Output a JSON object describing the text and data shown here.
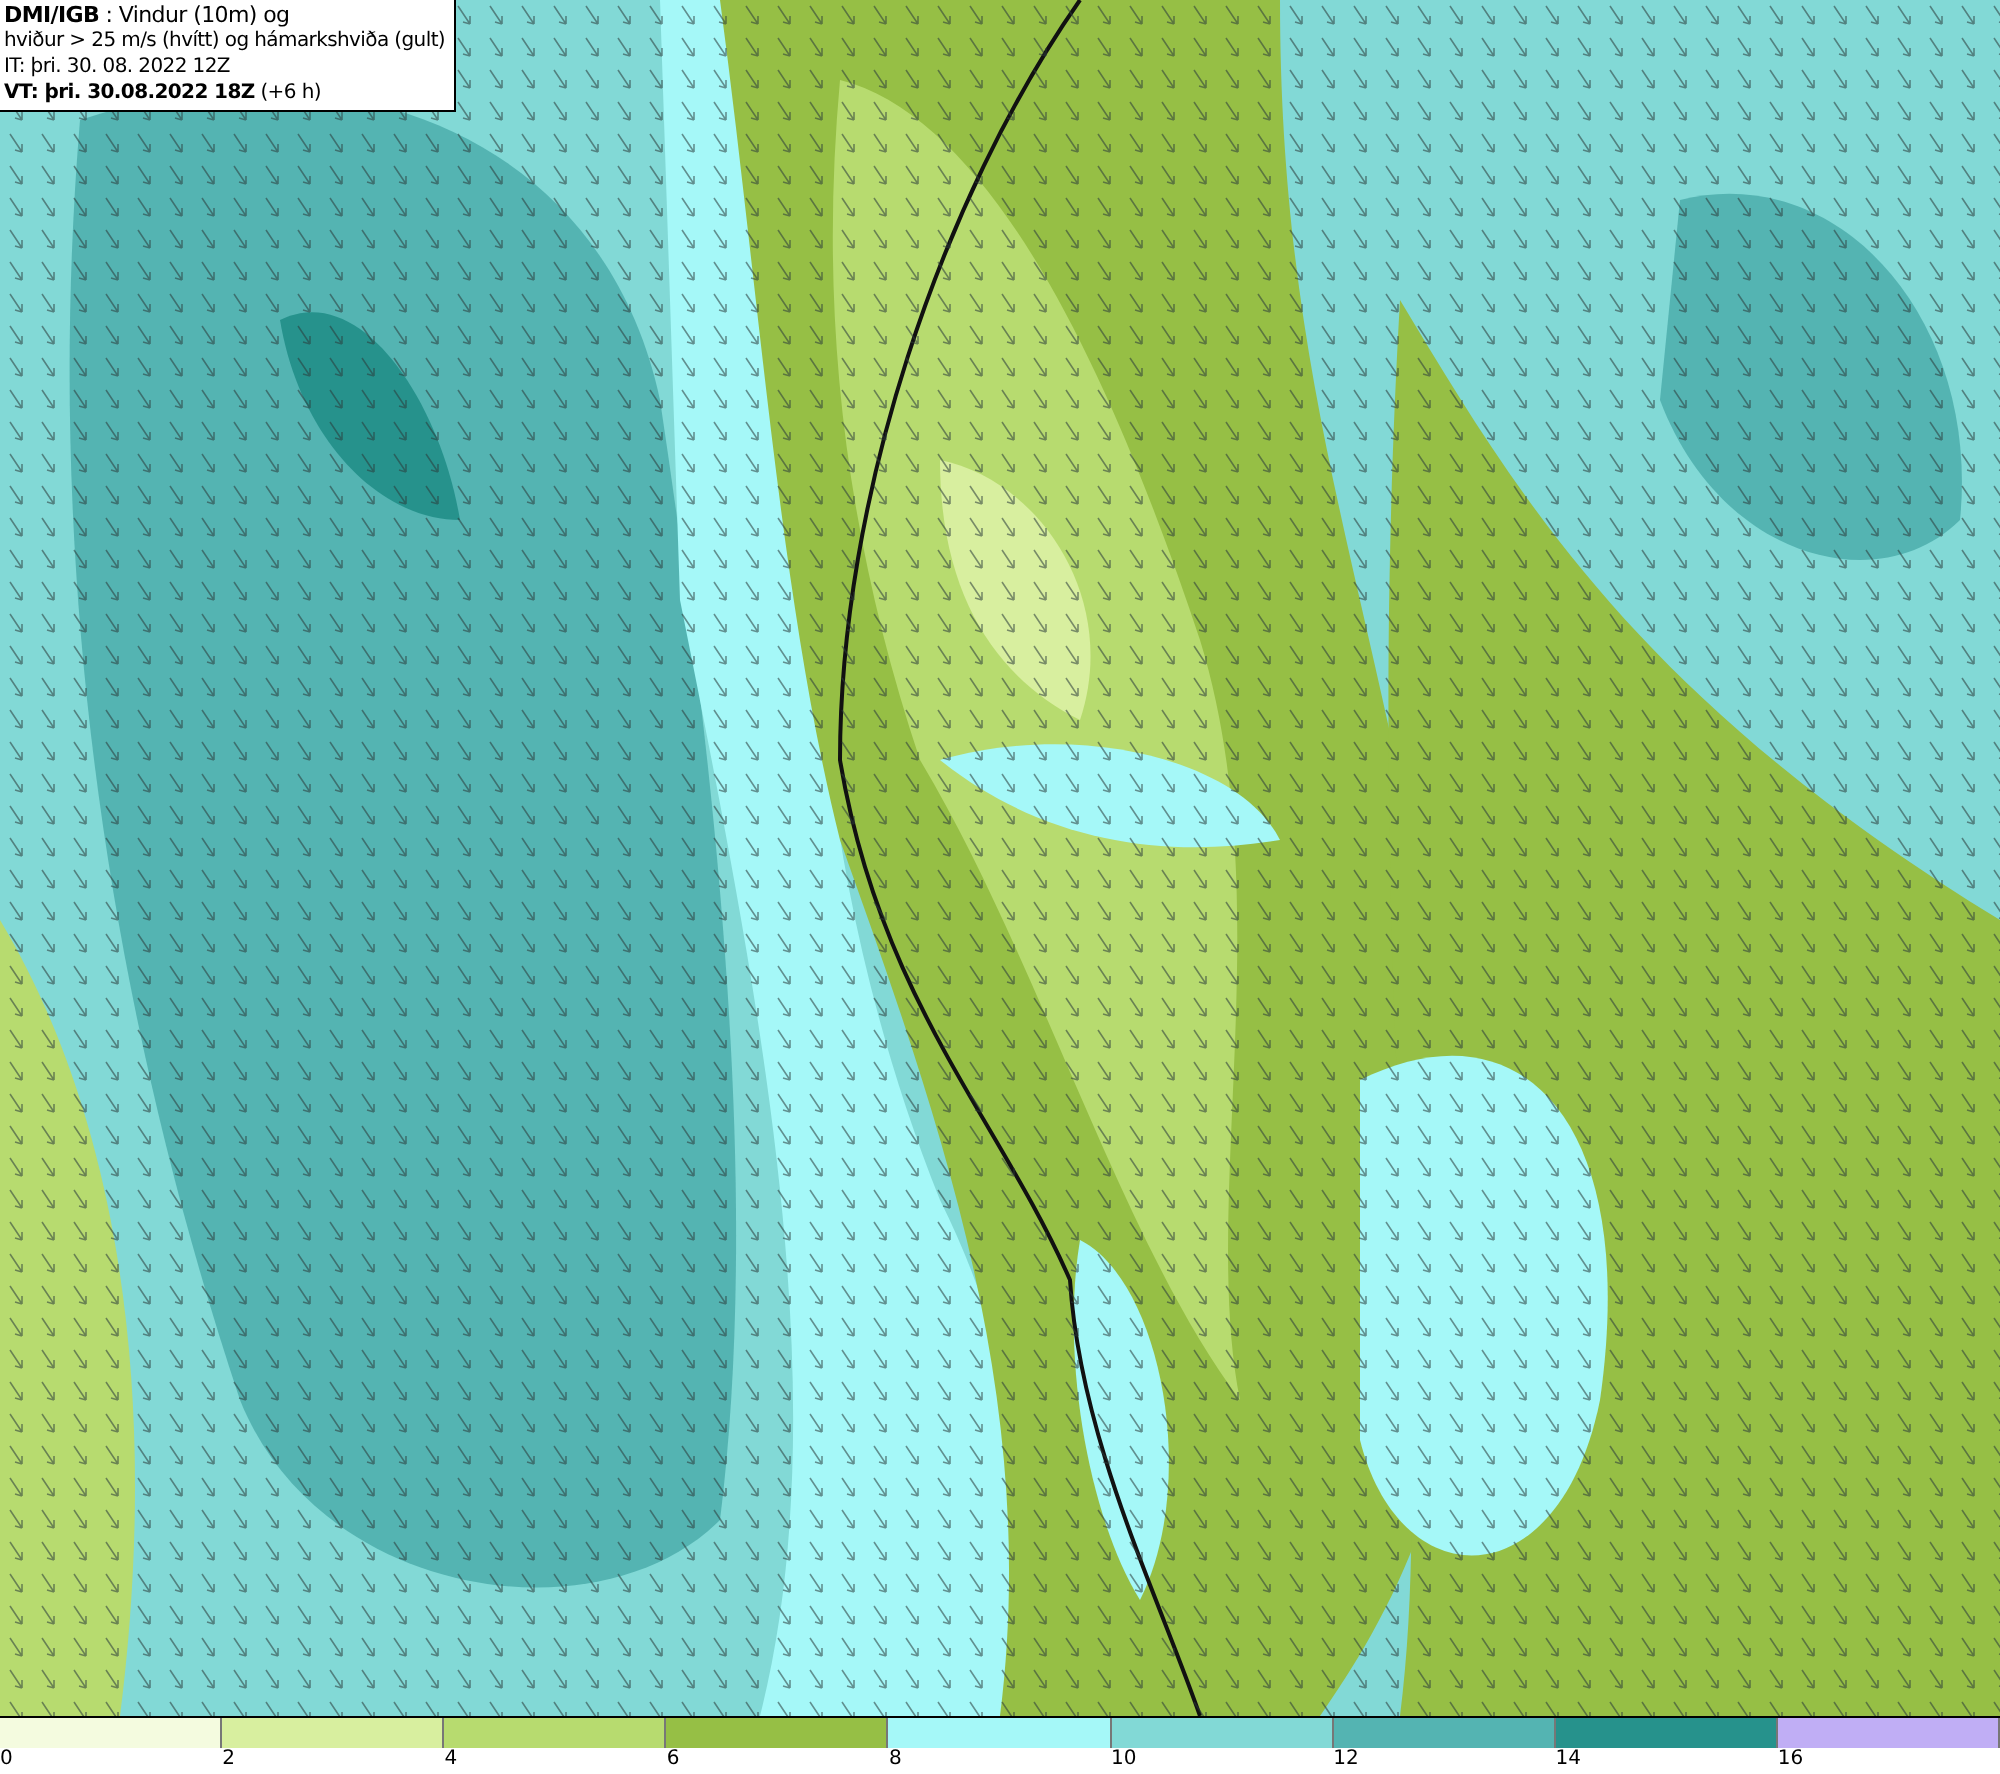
{
  "title_box": {
    "lines": [
      "**DMI/IGB** : Vindur (10m) og",
      "hviður > 25 m/s (hvítt) og hámarkshviða (gult)",
      "IT: þri. 30. 08. 2022 12Z",
      "**VT: þri. 30.08.2022 18Z** (+6 h)"
    ]
  },
  "legend": {
    "bins": [
      {
        "color": "#f4fbdf"
      },
      {
        "color": "#d8ef9f"
      },
      {
        "color": "#b7db6f"
      },
      {
        "color": "#96bf45"
      },
      {
        "color": "#a5f8f8"
      },
      {
        "color": "#82d9d6"
      },
      {
        "color": "#54b4b2"
      },
      {
        "color": "#26928c"
      },
      {
        "color": "#c0aef5"
      }
    ],
    "ticks": [
      "0",
      "2",
      "4",
      "6",
      "8",
      "10",
      "12",
      "14",
      "16"
    ]
  }
}
